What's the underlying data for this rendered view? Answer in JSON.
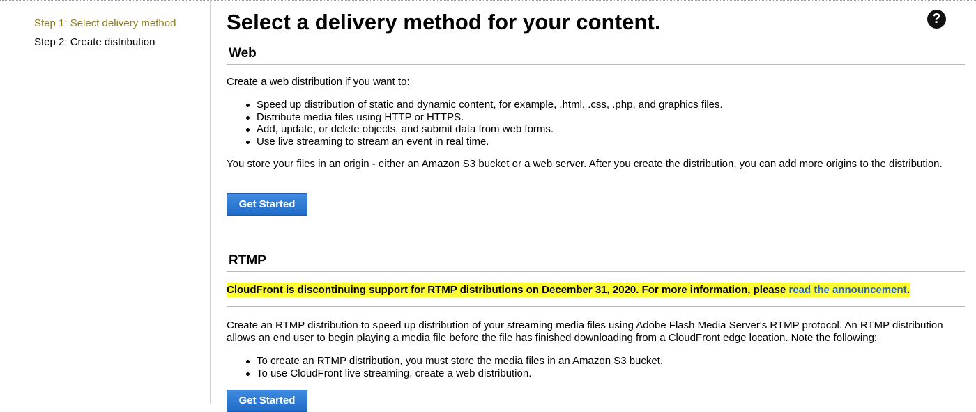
{
  "sidebar": {
    "items": [
      {
        "label": "Step 1: Select delivery method",
        "active": true
      },
      {
        "label": "Step 2: Create distribution",
        "active": false
      }
    ]
  },
  "main": {
    "title": "Select a delivery method for your content.",
    "help_icon": "question-circle-icon",
    "web": {
      "heading": "Web",
      "intro": "Create a web distribution if you want to:",
      "bullets": [
        "Speed up distribution of static and dynamic content, for example, .html, .css, .php, and graphics files.",
        "Distribute media files using HTTP or HTTPS.",
        "Add, update, or delete objects, and submit data from web forms.",
        "Use live streaming to stream an event in real time."
      ],
      "origin_text": "You store your files in an origin - either an Amazon S3 bucket or a web server. After you create the distribution, you can add more origins to the distribution.",
      "button_label": "Get Started"
    },
    "rtmp": {
      "heading": "RTMP",
      "notice_text": "CloudFront is discontinuing support for RTMP distributions on December 31, 2020. For more information, please ",
      "notice_link": "read the announcement",
      "notice_end": ".",
      "description": "Create an RTMP distribution to speed up distribution of your streaming media files using Adobe Flash Media Server's RTMP protocol. An RTMP distribution allows an end user to begin playing a media file before the file has finished downloading from a CloudFront edge location. Note the following:",
      "bullets": [
        "To create an RTMP distribution, you must store the media files in an Amazon S3 bucket.",
        "To use CloudFront live streaming, create a web distribution."
      ],
      "button_label": "Get Started"
    }
  },
  "colors": {
    "active_step": "#8c7c1e",
    "button": "#2a78d6",
    "notice_highlight": "#ffff33",
    "link": "#2b63b8"
  }
}
